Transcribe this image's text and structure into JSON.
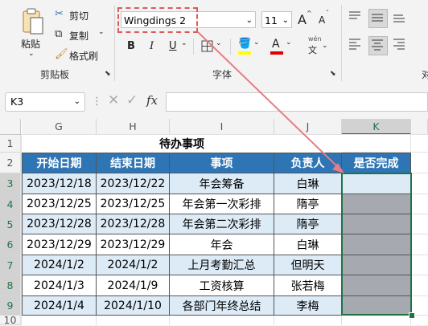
{
  "ribbon": {
    "clipboard": {
      "paste": "粘贴",
      "cut": "剪切",
      "copy": "复制",
      "format_painter": "格式刷",
      "group": "剪贴板"
    },
    "font": {
      "name": "Wingdings 2",
      "size": "11",
      "group": "字体",
      "bold": "B",
      "italic": "I",
      "underline": "U",
      "grow": "A",
      "shrink": "A",
      "phonetic_top": "wén",
      "phonetic_bottom": "文"
    },
    "next_group_partial": "对"
  },
  "formula_bar": {
    "name_box": "K3",
    "fx": "fx",
    "value": ""
  },
  "sheet": {
    "columns": [
      "G",
      "H",
      "I",
      "J",
      "K"
    ],
    "rows": [
      "1",
      "2",
      "3",
      "4",
      "5",
      "6",
      "7",
      "8",
      "9",
      "10"
    ],
    "title": "待办事项",
    "headers": [
      "开始日期",
      "结束日期",
      "事项",
      "负责人",
      "是否完成"
    ],
    "data": [
      [
        "2023/12/18",
        "2023/12/22",
        "年会筹备",
        "白琳",
        ""
      ],
      [
        "2023/12/25",
        "2023/12/25",
        "年会第一次彩排",
        "隋亭",
        ""
      ],
      [
        "2023/12/28",
        "2023/12/28",
        "年会第二次彩排",
        "隋亭",
        ""
      ],
      [
        "2023/12/29",
        "2023/12/29",
        "年会",
        "白琳",
        ""
      ],
      [
        "2024/1/2",
        "2024/1/2",
        "上月考勤汇总",
        "但明天",
        ""
      ],
      [
        "2024/1/3",
        "2024/1/9",
        "工资核算",
        "张若梅",
        ""
      ],
      [
        "2024/1/4",
        "2024/1/10",
        "各部门年终总结",
        "李梅",
        ""
      ]
    ]
  },
  "colors": {
    "header_fill": "#2e75b6",
    "band_fill": "#ddebf7",
    "selected_gray": "#a6aab0",
    "selection_border": "#217346",
    "annotation": "#e05a5a"
  }
}
